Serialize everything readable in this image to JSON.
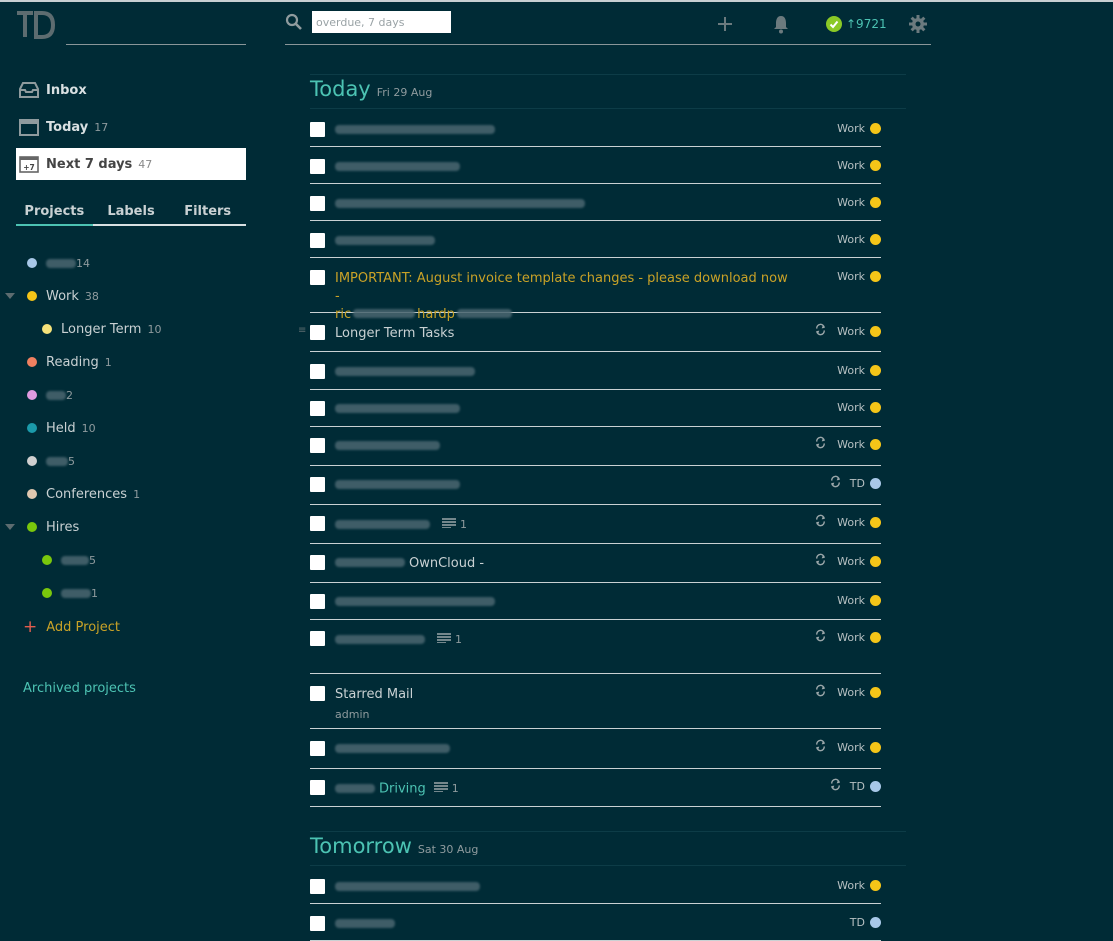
{
  "app": {
    "logo_text": "TD"
  },
  "search": {
    "placeholder": "overdue, 7 days"
  },
  "karma": {
    "value": "↑9721",
    "color": "#8ac926"
  },
  "nav": [
    {
      "label": "Inbox",
      "count": "",
      "icon": "inbox-icon"
    },
    {
      "label": "Today",
      "count": "17",
      "icon": "calendar-icon"
    },
    {
      "label": "Next 7 days",
      "count": "47",
      "icon": "calendar-plus7-icon",
      "icon_text": "+7"
    }
  ],
  "tabs": [
    "Projects",
    "Labels",
    "Filters"
  ],
  "projects": [
    {
      "name": "",
      "count": "14",
      "color": "#a8c8e8",
      "blurred": true
    },
    {
      "name": "Work",
      "count": "38",
      "color": "#f5c518",
      "collapsible": true
    },
    {
      "name": "Longer Term",
      "count": "10",
      "color": "#f5e27a",
      "indent": true
    },
    {
      "name": "Reading",
      "count": "1",
      "color": "#f08060"
    },
    {
      "name": "",
      "count": "2",
      "color": "#e09ae0",
      "blurred": true
    },
    {
      "name": "Held",
      "count": "10",
      "color": "#1b9aaa"
    },
    {
      "name": "",
      "count": "5",
      "color": "#d0d0d0",
      "blurred": true
    },
    {
      "name": "Conferences",
      "count": "1",
      "color": "#e0c8b0"
    },
    {
      "name": "Hires",
      "count": "",
      "color": "#7ac70c",
      "collapsible": true
    },
    {
      "name": "",
      "count": "5",
      "color": "#7ac70c",
      "indent": true,
      "blurred": true
    },
    {
      "name": "",
      "count": "1",
      "color": "#7ac70c",
      "indent": true,
      "blurred": true
    }
  ],
  "add_project": "Add Project",
  "archived": "Archived projects",
  "today": {
    "title": "Today",
    "date": "Fri 29 Aug"
  },
  "tomorrow": {
    "title": "Tomorrow",
    "date": "Sat 30 Aug"
  },
  "tasks_today": [
    {
      "text": "",
      "project": "Work",
      "color": "#f5c518"
    },
    {
      "text": "",
      "project": "Work",
      "color": "#f5c518"
    },
    {
      "text": "",
      "project": "Work",
      "color": "#f5c518"
    },
    {
      "text": "",
      "project": "Work",
      "color": "#f5c518"
    },
    {
      "text": "IMPORTANT: August invoice template changes - please download now -",
      "text2": "ric",
      "text3": "hardp",
      "project": "Work",
      "color": "#f5c518",
      "style": "warn"
    },
    {
      "text": "Longer Term Tasks",
      "project": "Work",
      "color": "#f5c518",
      "recurring": true
    },
    {
      "text": "",
      "project": "Work",
      "color": "#f5c518"
    },
    {
      "text": "",
      "project": "Work",
      "color": "#f5c518"
    },
    {
      "text": "",
      "project": "Work",
      "color": "#f5c518",
      "recurring": true
    },
    {
      "text": "",
      "project": "TD",
      "color": "#a8c8e8",
      "recurring": true
    },
    {
      "text": "",
      "project": "Work",
      "color": "#f5c518",
      "recurring": true,
      "notes": "1"
    },
    {
      "text": "OwnCloud -",
      "project": "Work",
      "color": "#f5c518",
      "recurring": true
    },
    {
      "text": "",
      "project": "Work",
      "color": "#f5c518"
    },
    {
      "text": "",
      "project": "Work",
      "color": "#f5c518",
      "recurring": true,
      "notes": "1"
    },
    {
      "text": "Starred Mail",
      "sub": "admin",
      "project": "Work",
      "color": "#f5c518",
      "recurring": true
    },
    {
      "text": "",
      "project": "Work",
      "color": "#f5c518",
      "recurring": true
    },
    {
      "text": "Driving",
      "project": "TD",
      "color": "#a8c8e8",
      "recurring": true,
      "notes": "1",
      "style": "link"
    }
  ],
  "tasks_tomorrow": [
    {
      "text": "",
      "project": "Work",
      "color": "#f5c518"
    },
    {
      "text": "",
      "project": "TD",
      "color": "#a8c8e8"
    }
  ]
}
